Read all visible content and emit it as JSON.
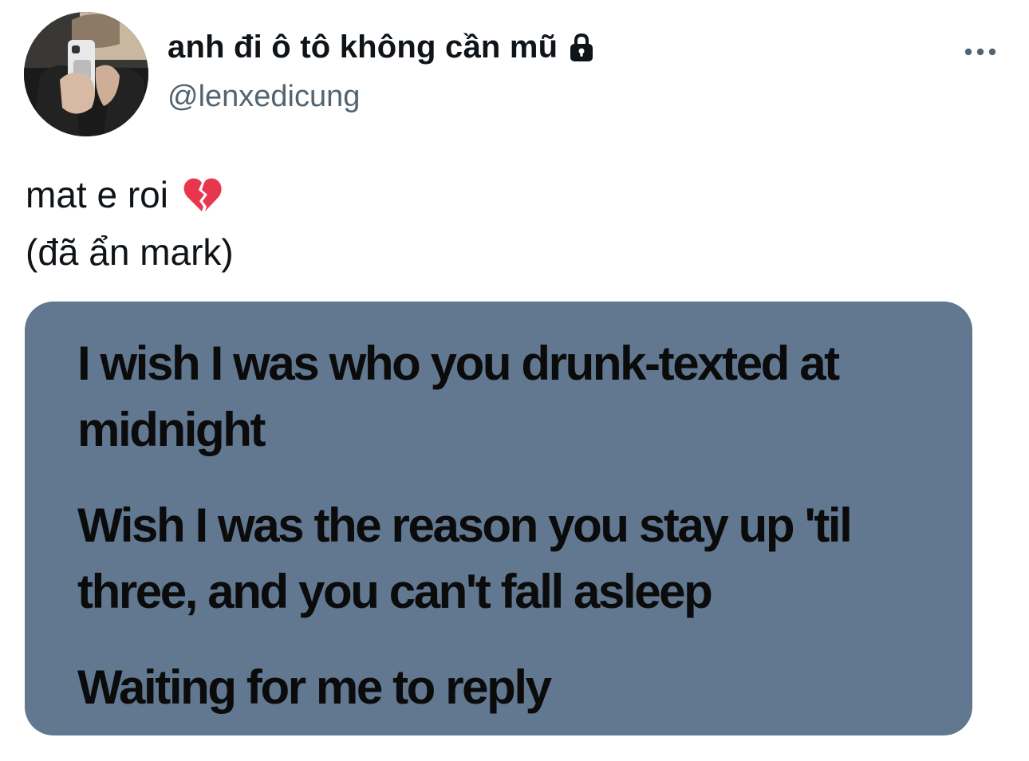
{
  "author": {
    "display_name": "anh đi ô tô không cần mũ",
    "handle": "@lenxedicung",
    "lock_icon": "lock-icon"
  },
  "menu": {
    "more_icon": "more-horizontal-icon"
  },
  "tweet": {
    "line1": "mat e roi",
    "emoji": "broken-heart-icon",
    "line2": "(đã ẩn mark)"
  },
  "media": {
    "background": "#617890",
    "lyrics": [
      "I wish I was who you drunk-texted at midnight",
      "Wish I was the reason you stay up 'til three, and you can't fall asleep",
      "Waiting for me to reply"
    ]
  },
  "colors": {
    "text_primary": "#0f1419",
    "text_secondary": "#536471",
    "heart": "#e8364d"
  }
}
